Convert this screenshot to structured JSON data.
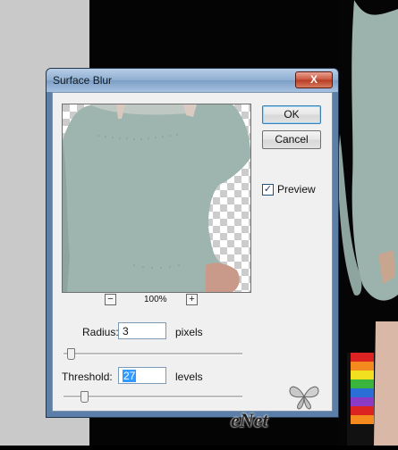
{
  "dialog": {
    "title": "Surface Blur",
    "close_icon": "X"
  },
  "buttons": {
    "ok": "OK",
    "cancel": "Cancel"
  },
  "preview_toggle": {
    "label": "Preview",
    "checked": true,
    "checkmark": "✓"
  },
  "zoom": {
    "minus": "−",
    "level": "100%",
    "plus": "+"
  },
  "radius": {
    "label": "Radius:",
    "value": "3",
    "unit": "pixels",
    "slider_fraction": 0.02
  },
  "threshold": {
    "label": "Threshold:",
    "value": "27",
    "unit": "levels",
    "slider_fraction": 0.1
  },
  "watermark": {
    "text": "eNet"
  },
  "colors": {
    "accent": "#3399ff",
    "sweater": "#9fb7b1",
    "titlebar": "#8eaed2"
  }
}
